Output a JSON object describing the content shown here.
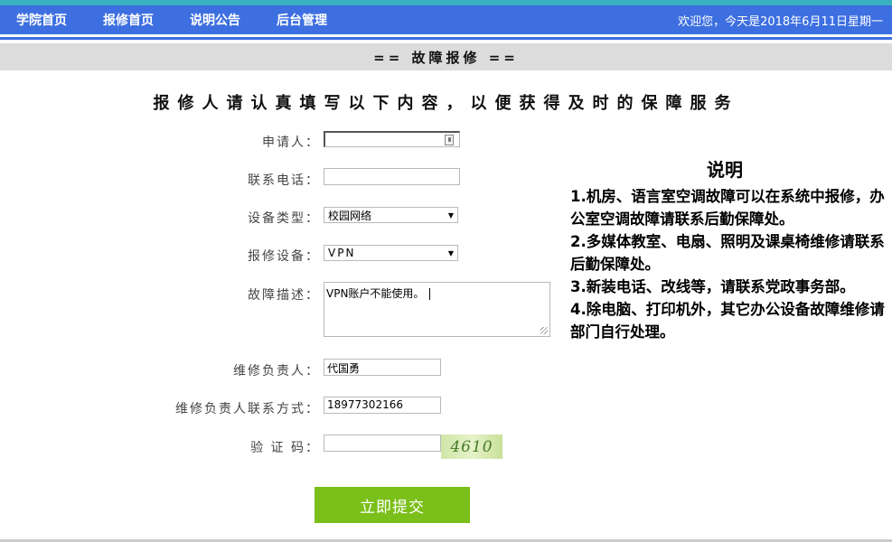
{
  "nav": {
    "items": [
      "学院首页",
      "报修首页",
      "说明公告",
      "后台管理"
    ],
    "welcome": "欢迎您，今天是2018年6月11日星期一"
  },
  "section_title": "== 故障报修 ==",
  "heading": "报修人请认真填写以下内容，以便获得及时的保障服务",
  "form": {
    "applicant": {
      "label": "申请人：",
      "value": ""
    },
    "phone": {
      "label": "联系电话：",
      "value": ""
    },
    "device_type": {
      "label": "设备类型：",
      "value": "校园网络"
    },
    "device": {
      "label": "报修设备：",
      "value": "VPN"
    },
    "description": {
      "label": "故障描述：",
      "value": "VPN账户不能使用。"
    },
    "responsible": {
      "label": "维修负责人：",
      "value": "代国勇"
    },
    "responsible_contact": {
      "label": "维修负责人联系方式：",
      "value": "18977302166"
    },
    "captcha": {
      "label": "验 证 码：",
      "value": "",
      "image_text": "4610"
    },
    "submit": "立即提交"
  },
  "notes": {
    "title": "说明",
    "items": [
      "1.机房、语言室空调故障可以在系统中报修，办公室空调故障请联系后勤保障处。",
      "2.多媒体教室、电扇、照明及课桌椅维修请联系后勤保障处。",
      "3.新装电话、改线等，请联系党政事务部。",
      "4.除电脑、打印机外，其它办公设备故障维修请部门自行处理。"
    ]
  },
  "colors": {
    "nav_bg": "#3d6fe0",
    "accent": "#3ab0c0",
    "submit_bg": "#7bbf1a"
  }
}
